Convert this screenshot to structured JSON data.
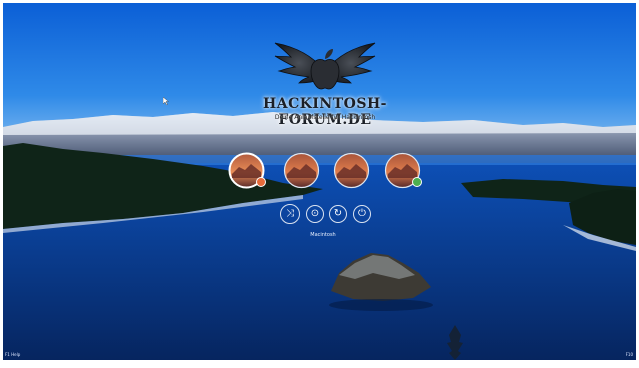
{
  "boot_menu": {
    "brand": "HACKINTOSH-FORUM.DE",
    "tagline": "Deine Anlaufstelle für Hackintosh",
    "entries": [
      {
        "name": "macos-high-sierra",
        "badge_color": "#e56a3a",
        "selected": true
      },
      {
        "name": "macos-high-sierra",
        "badge_color": null,
        "selected": false
      },
      {
        "name": "macos-high-sierra",
        "badge_color": null,
        "selected": false
      },
      {
        "name": "macos-high-sierra",
        "badge_color": "#4caf50",
        "selected": false
      }
    ],
    "selected_label": "Macintosh",
    "tools": [
      {
        "name": "options-icon",
        "glyph": "⤨"
      },
      {
        "name": "about-icon",
        "glyph": "⊙"
      },
      {
        "name": "restart-icon",
        "glyph": "↻"
      },
      {
        "name": "shutdown-icon",
        "glyph": "⏻"
      }
    ],
    "corner_left": "F1 Help",
    "corner_right": "F10"
  }
}
